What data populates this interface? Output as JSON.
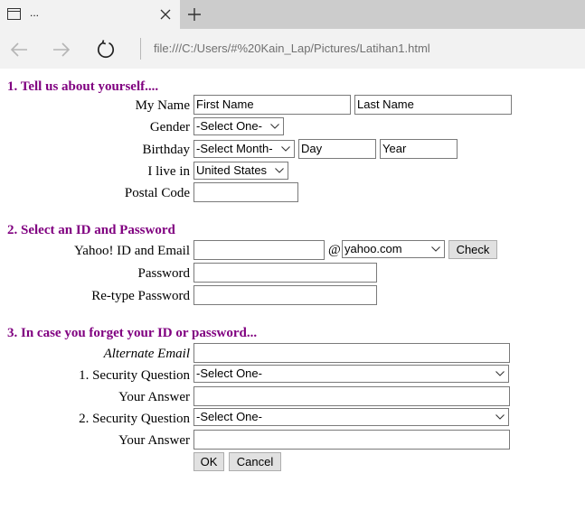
{
  "browser": {
    "tab_title": "...",
    "address": "file:///C:/Users/#%20Kain_Lap/Pictures/Latihan1.html"
  },
  "section1": {
    "heading": "1. Tell us about yourself....",
    "my_name_label": "My Name",
    "first_name_value": "First Name",
    "last_name_value": "Last Name",
    "gender_label": "Gender",
    "gender_selected": "-Select One-",
    "birthday_label": "Birthday",
    "birthday_month_selected": "-Select Month-",
    "birthday_day_value": "Day",
    "birthday_year_value": "Year",
    "live_in_label": "I live in",
    "country_selected": "United States",
    "postal_code_label": "Postal Code",
    "postal_code_value": ""
  },
  "section2": {
    "heading": "2. Select an ID and Password",
    "yahoo_id_label": "Yahoo! ID and Email",
    "yahoo_id_value": "",
    "at_sign": "@",
    "domain_selected": "yahoo.com",
    "check_button": "Check",
    "password_label": "Password",
    "retype_password_label": "Re-type Password"
  },
  "section3": {
    "heading": "3. In case you forget your ID or password...",
    "alternate_email_label": "Alternate Email",
    "security_question_1_label": "1. Security Question",
    "security_question_1_selected": "-Select One-",
    "answer_1_label": "Your Answer",
    "security_question_2_label": "2. Security Question",
    "security_question_2_selected": "-Select One-",
    "answer_2_label": "Your Answer"
  },
  "actions": {
    "ok_button": "OK",
    "cancel_button": "Cancel"
  }
}
